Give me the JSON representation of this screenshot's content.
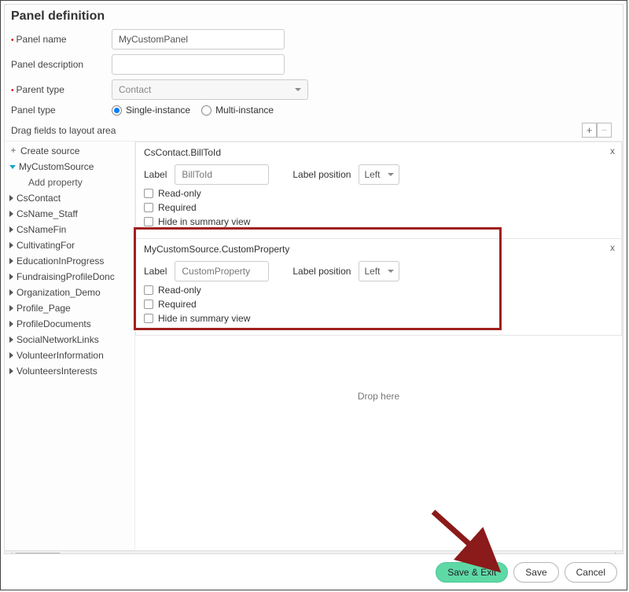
{
  "title": "Panel definition",
  "labels": {
    "panel_name": "Panel name",
    "panel_description": "Panel description",
    "parent_type": "Parent type",
    "panel_type": "Panel type",
    "drag_fields": "Drag fields to layout area"
  },
  "values": {
    "panel_name": "MyCustomPanel",
    "panel_description": "",
    "parent_type": "Contact"
  },
  "panel_type_options": {
    "single": "Single-instance",
    "multi": "Multi-instance"
  },
  "tree": {
    "create_source": "Create source",
    "my_custom_source": "MyCustomSource",
    "add_property": "Add property",
    "items": [
      "CsContact",
      "CsName_Staff",
      "CsNameFin",
      "CultivatingFor",
      "EducationInProgress",
      "FundraisingProfileDonc",
      "Organization_Demo",
      "Profile_Page",
      "ProfileDocuments",
      "SocialNetworkLinks",
      "VolunteerInformation",
      "VolunteersInterests"
    ]
  },
  "cards": [
    {
      "title": "CsContact.BillToId",
      "label_text": "Label",
      "label_value": "BillToId",
      "label_position_text": "Label position",
      "label_position_value": "Left",
      "opts": {
        "readonly": "Read-only",
        "required": "Required",
        "hide": "Hide in summary view"
      }
    },
    {
      "title": "MyCustomSource.CustomProperty",
      "label_text": "Label",
      "label_value": "CustomProperty",
      "label_position_text": "Label position",
      "label_position_value": "Left",
      "opts": {
        "readonly": "Read-only",
        "required": "Required",
        "hide": "Hide in summary view"
      }
    }
  ],
  "dropzone": "Drop here",
  "buttons": {
    "save_exit": "Save & Exit",
    "save": "Save",
    "cancel": "Cancel"
  },
  "pm": {
    "plus": "+",
    "minus": "−"
  }
}
